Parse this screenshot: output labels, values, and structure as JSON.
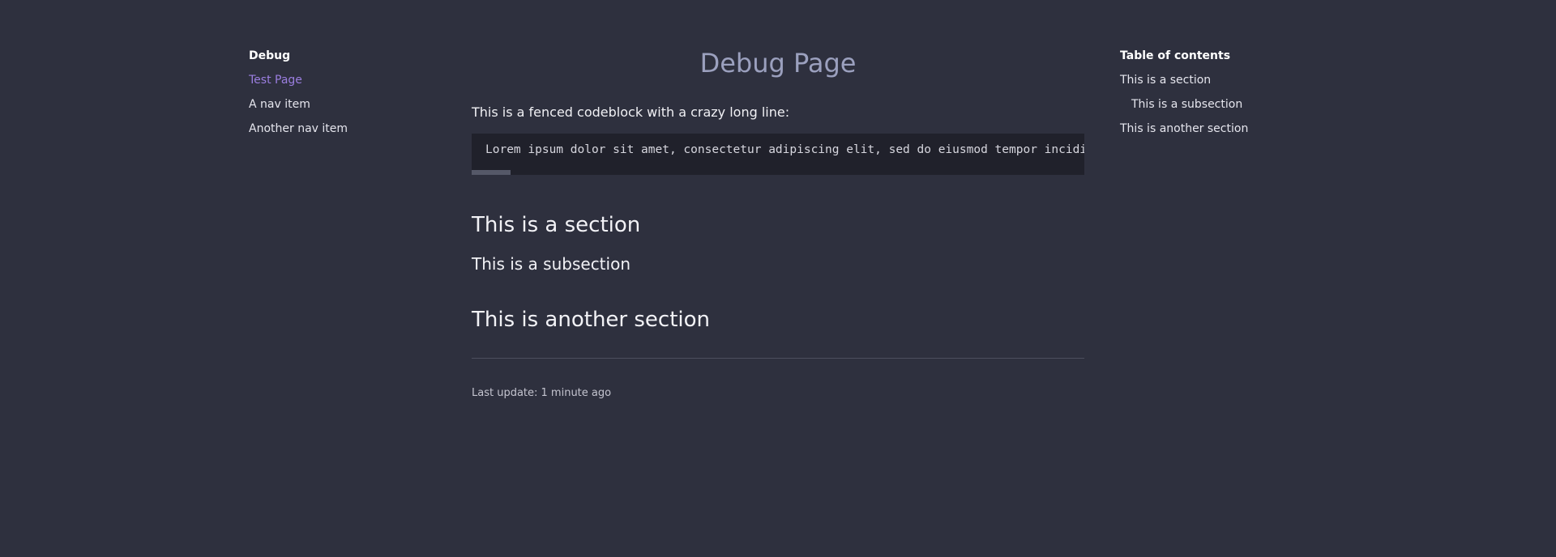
{
  "left_nav": {
    "heading": "Debug",
    "items": [
      {
        "label": "Test Page",
        "active": true
      },
      {
        "label": "A nav item",
        "active": false
      },
      {
        "label": "Another nav item",
        "active": false
      }
    ]
  },
  "main": {
    "title": "Debug Page",
    "intro": "This is a fenced codeblock with a crazy long line:",
    "code": "Lorem ipsum dolor sit amet, consectetur adipiscing elit, sed do eiusmod tempor incididunt ut labore et dolore magna aliqua. Ut enim ad minim veniam, quis nostrud exercitation ullamco laboris nisi ut aliquip ex ea commodo consequat.",
    "section_1": "This is a section",
    "subsection_1": "This is a subsection",
    "section_2": "This is another section",
    "last_update": "Last update: 1 minute ago"
  },
  "toc": {
    "heading": "Table of contents",
    "items": [
      {
        "label": "This is a section",
        "level": 1
      },
      {
        "label": "This is a subsection",
        "level": 2
      },
      {
        "label": "This is another section",
        "level": 1
      }
    ]
  },
  "colors": {
    "background": "#2e303e",
    "code_background": "#20212b",
    "accent": "#9b7ee0",
    "title": "#9ba0be"
  }
}
